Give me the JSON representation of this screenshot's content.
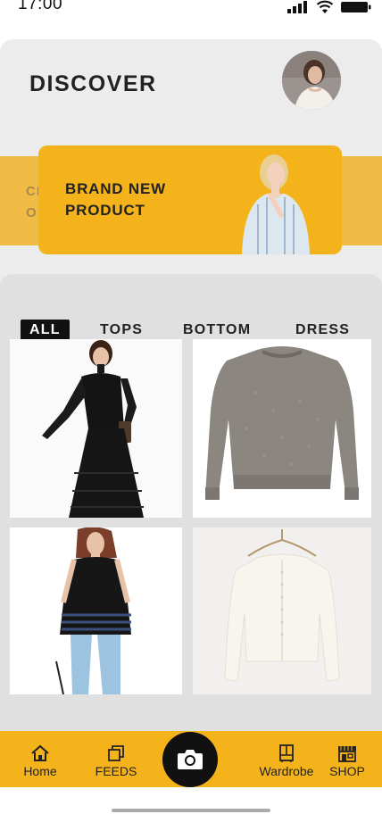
{
  "status_bar": {
    "time": "17:00",
    "icons": [
      "cellular-signal-icon",
      "wifi-icon",
      "battery-icon"
    ]
  },
  "header": {
    "title": "DISCOVER",
    "avatar": "profile-avatar"
  },
  "banner": {
    "title_line1": "BRAND NEW",
    "title_line2": "PRODUCT",
    "peek_line1": "CI",
    "peek_line2": "O"
  },
  "tabs": [
    {
      "label": "ALL",
      "active": true
    },
    {
      "label": "TOPS",
      "active": false
    },
    {
      "label": "BOTTOM",
      "active": false
    },
    {
      "label": "DRESS",
      "active": false
    }
  ],
  "products": [
    {
      "name": "black-lace-dress"
    },
    {
      "name": "grey-knit-sweater"
    },
    {
      "name": "black-sheer-top"
    },
    {
      "name": "white-cardigan"
    }
  ],
  "bottom_nav": {
    "items": [
      {
        "label": "Home",
        "icon": "home-icon"
      },
      {
        "label": "FEEDS",
        "icon": "feeds-icon"
      },
      {
        "label": "Wardrobe",
        "icon": "wardrobe-icon"
      },
      {
        "label": "SHOP",
        "icon": "shop-icon"
      }
    ],
    "camera_icon": "camera-icon"
  },
  "colors": {
    "accent": "#f4b31a",
    "background": "#ececec",
    "panel": "#e0e0e0",
    "text": "#222222"
  }
}
